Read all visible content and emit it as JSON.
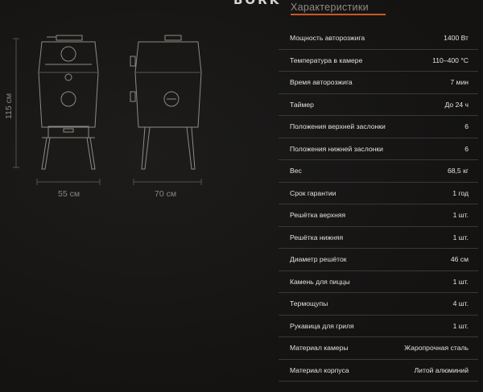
{
  "header": {
    "brand": "BORK",
    "tab_title": "Характеристики"
  },
  "drawing": {
    "height_label": "115 см",
    "width_label": "55 см",
    "depth_label": "70 см"
  },
  "specs": [
    {
      "key": "Мощность автоpозжига",
      "value": "1400 Вт"
    },
    {
      "key": "Температура в камере",
      "value": "110–400 °C"
    },
    {
      "key": "Время автоpозжига",
      "value": "7 мин"
    },
    {
      "key": "Таймер",
      "value": "До 24 ч"
    },
    {
      "key": "Положения верхней заслонки",
      "value": "6"
    },
    {
      "key": "Положения нижней заслонки",
      "value": "6"
    },
    {
      "key": "Вес",
      "value": "68,5 кг"
    },
    {
      "key": "Срок гарантии",
      "value": "1 год"
    },
    {
      "key": "Решётка верхняя",
      "value": "1 шт."
    },
    {
      "key": "Решётка нижняя",
      "value": "1 шт."
    },
    {
      "key": "Диаметр решёток",
      "value": "46 см"
    },
    {
      "key": "Камень для пиццы",
      "value": "1 шт."
    },
    {
      "key": "Термощупы",
      "value": "4 шт."
    },
    {
      "key": "Рукавица для гриля",
      "value": "1 шт."
    },
    {
      "key": "Материал камеры",
      "value": "Жаропрочная сталь"
    },
    {
      "key": "Материал корпуса",
      "value": "Литой алюминий"
    }
  ]
}
